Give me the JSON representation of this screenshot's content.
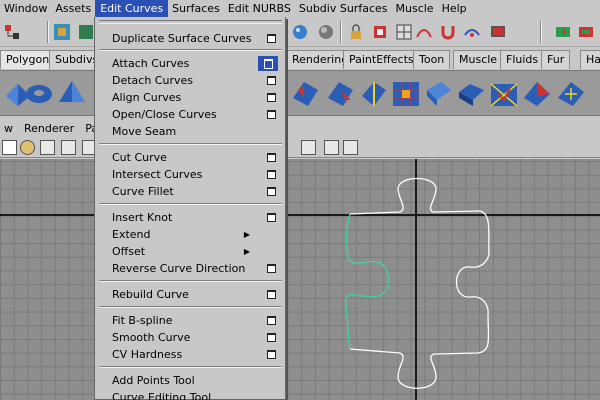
{
  "menubar": {
    "items": [
      "Window",
      "Assets",
      "Edit Curves",
      "Surfaces",
      "Edit NURBS",
      "Subdiv Surfaces",
      "Muscle",
      "Help"
    ],
    "active_index": 2
  },
  "shelf_tabs": [
    "Polygons",
    "Subdivs",
    "Rendering",
    "PaintEffects",
    "Toon",
    "Muscle",
    "Fluids",
    "Fur",
    "Ha"
  ],
  "panel_menu": [
    "w",
    "Renderer",
    "Pane"
  ],
  "dropdown": {
    "items": [
      {
        "label": "Duplicate Surface Curves",
        "option": true
      },
      {
        "label": "Attach Curves",
        "option": true,
        "highlighted_option": true
      },
      {
        "label": "Detach Curves",
        "option": true
      },
      {
        "label": "Align Curves",
        "option": true
      },
      {
        "label": "Open/Close Curves",
        "option": true
      },
      {
        "label": "Move Seam",
        "option": false
      },
      {
        "label": "Cut Curve",
        "option": true
      },
      {
        "label": "Intersect Curves",
        "option": true
      },
      {
        "label": "Curve Fillet",
        "option": true
      },
      {
        "label": "Insert Knot",
        "option": true
      },
      {
        "label": "Extend",
        "submenu": true
      },
      {
        "label": "Offset",
        "submenu": true
      },
      {
        "label": "Reverse Curve Direction",
        "option": true
      },
      {
        "label": "Rebuild Curve",
        "option": true
      },
      {
        "label": "Fit B-spline",
        "option": true
      },
      {
        "label": "Smooth Curve",
        "option": true
      },
      {
        "label": "CV Hardness",
        "option": true
      },
      {
        "label": "Add Points Tool",
        "option": false
      },
      {
        "label": "Curve Editing Tool",
        "option": false
      }
    ]
  },
  "icons": {
    "submenu_arrow": "▶"
  },
  "colors": {
    "menu_highlight": "#2a4fb5",
    "selected_curve": "#3fd3a3",
    "unselected_curve": "#ffffff"
  }
}
